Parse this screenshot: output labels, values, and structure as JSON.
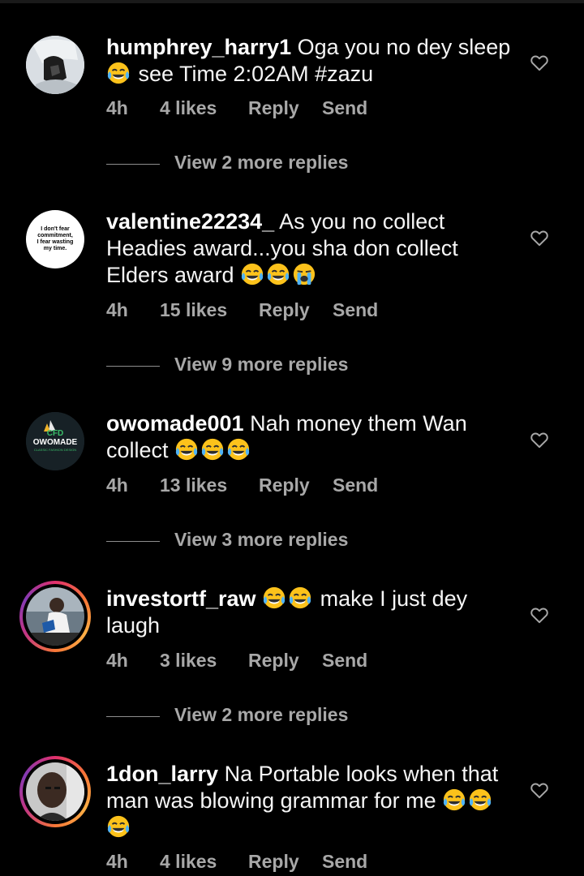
{
  "colors": {
    "background": "#000000",
    "text": "#f5f5f5",
    "secondary": "#a8a8a8",
    "story_ring": "#e1306c"
  },
  "comments": [
    {
      "username": "humphrey_harry1",
      "text_before_emoji": "Oga you no dey sleep",
      "emojis_mid": [
        "face-with-tears-of-joy"
      ],
      "text_after_emoji": "see Time 2:02AM #zazu",
      "emojis_end": [],
      "time": "4h",
      "likes": "4 likes",
      "reply": "Reply",
      "send": "Send",
      "view_replies": "View 2 more replies",
      "avatar": "photo",
      "story_ring": false
    },
    {
      "username": "valentine22234_",
      "text_before_emoji": "As you no collect Headies award...you sha don collect Elders award",
      "emojis_mid": [
        "face-with-tears-of-joy",
        "face-with-tears-of-joy",
        "loudly-crying-face"
      ],
      "text_after_emoji": "",
      "emojis_end": [],
      "time": "4h",
      "likes": "15 likes",
      "reply": "Reply",
      "send": "Send",
      "view_replies": "View 9 more replies",
      "avatar": "text-avatar",
      "avatar_text": [
        "I don't fear",
        "commitment,",
        "I fear wasting",
        "my time."
      ],
      "story_ring": false
    },
    {
      "username": "owomade001",
      "text_before_emoji": "Nah money them Wan collect",
      "emojis_mid": [
        "face-with-tears-of-joy",
        "face-with-tears-of-joy",
        "face-with-tears-of-joy"
      ],
      "text_after_emoji": "",
      "emojis_end": [],
      "time": "4h",
      "likes": "13 likes",
      "reply": "Reply",
      "send": "Send",
      "view_replies": "View 3 more replies",
      "avatar": "logo",
      "avatar_text": [
        "CFD",
        "OWOMADE",
        "CLASSIC FASHION DESIGN"
      ],
      "story_ring": false
    },
    {
      "username": "investortf_raw",
      "text_before_emoji": "",
      "emojis_mid": [
        "face-with-tears-of-joy",
        "face-with-tears-of-joy"
      ],
      "text_after_emoji": "make I just dey laugh",
      "emojis_end": [],
      "time": "4h",
      "likes": "3 likes",
      "reply": "Reply",
      "send": "Send",
      "view_replies": "View 2 more replies",
      "avatar": "photo",
      "story_ring": true
    },
    {
      "username": "1don_larry",
      "text_before_emoji": "Na Portable looks when that man was blowing grammar for me",
      "emojis_mid": [
        "face-with-tears-of-joy",
        "face-with-tears-of-joy",
        "face-with-tears-of-joy"
      ],
      "text_after_emoji": "",
      "emojis_end": [],
      "time": "4h",
      "likes": "4 likes",
      "reply": "Reply",
      "send": "Send",
      "view_replies": "",
      "avatar": "photo",
      "story_ring": true
    }
  ]
}
